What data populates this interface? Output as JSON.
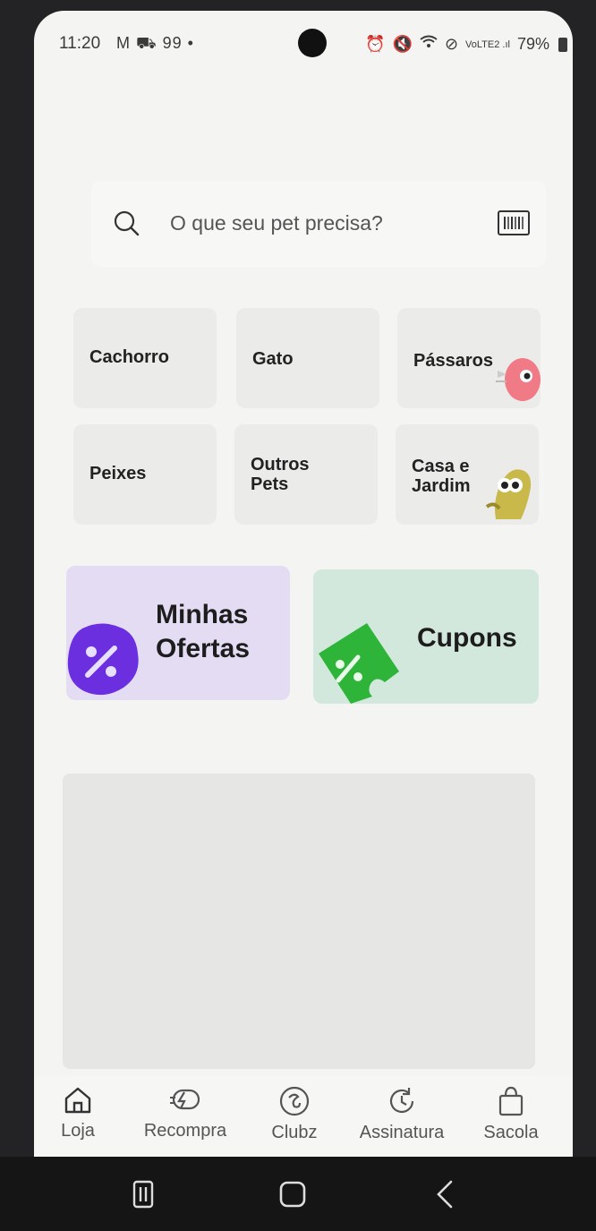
{
  "status_bar": {
    "time": "11:20",
    "left_icons_text": "M ⛟ 99 •",
    "right_text": "VoLTE2 .ıl",
    "battery": "79%"
  },
  "search": {
    "placeholder": "O que seu pet precisa?"
  },
  "categories": [
    {
      "label": "Cachorro"
    },
    {
      "label": "Gato"
    },
    {
      "label": "Pássaros"
    },
    {
      "label": "Peixes"
    },
    {
      "label": "Outros\nPets"
    },
    {
      "label": "Casa e\nJardim"
    }
  ],
  "promos": {
    "offers": {
      "title": "Minhas\nOfertas",
      "bg": "#e4dcf2",
      "badge_color": "#6b2fe0"
    },
    "coupons": {
      "title": "Cupons",
      "bg": "#d3e8dc",
      "badge_color": "#2fb43a"
    }
  },
  "bottom_nav": [
    {
      "label": "Loja",
      "icon": "home-icon"
    },
    {
      "label": "Recompra",
      "icon": "repurchase-icon"
    },
    {
      "label": "Clubz",
      "icon": "clubz-icon"
    },
    {
      "label": "Assinatura",
      "icon": "subscription-icon"
    },
    {
      "label": "Sacola",
      "icon": "bag-icon"
    }
  ],
  "system_nav": {
    "recents_icon": "recents-icon",
    "home_icon": "home-button-icon",
    "back_icon": "back-icon"
  }
}
